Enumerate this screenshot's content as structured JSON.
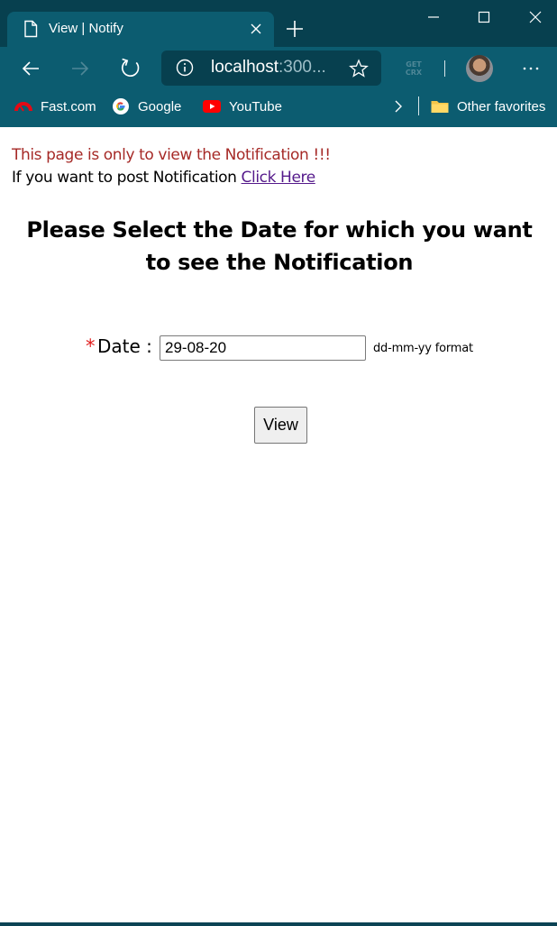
{
  "browser": {
    "tab_title": "View | Notify",
    "address": {
      "host": "localhost",
      "port_truncated": ":300..."
    },
    "crx_label_top": "GET",
    "crx_label_bottom": "CRX",
    "bookmarks": [
      {
        "label": "Fast.com",
        "icon": "speedometer-icon"
      },
      {
        "label": "Google",
        "icon": "google-icon"
      },
      {
        "label": "YouTube",
        "icon": "youtube-icon"
      }
    ],
    "other_favorites": "Other favorites",
    "colors": {
      "titlebar": "#07404f",
      "toolbar": "#0c5c70",
      "text": "#ffffff"
    }
  },
  "page": {
    "notice": "This page is only to view the Notification !!!",
    "post_prefix": "If you want to post Notification ",
    "post_link": "Click Here",
    "heading": "Please Select the Date for which you want to see the Notification",
    "date": {
      "required_mark": "*",
      "label": "Date :",
      "value": "29-08-20",
      "hint": "dd-mm-yy format"
    },
    "view_button": "View",
    "colors": {
      "notice": "#a62a27",
      "link": "#551a8b",
      "required": "#e01b1b"
    }
  }
}
